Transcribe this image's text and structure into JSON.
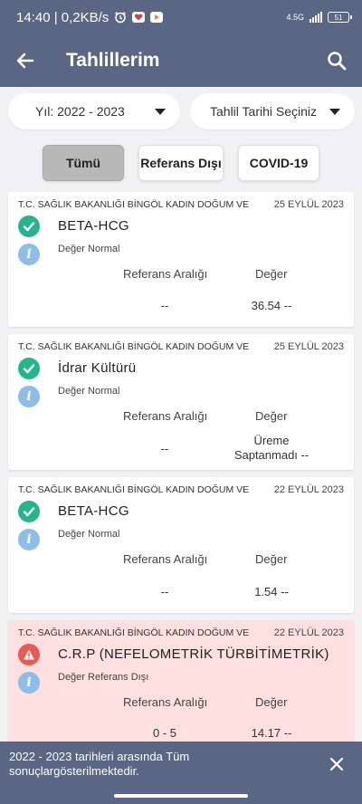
{
  "status_bar": {
    "time_speed": "14:40 | 0,2KB/s",
    "network_label": "4.5G",
    "battery_level": "51"
  },
  "app_bar": {
    "title": "Tahlillerim"
  },
  "filters": {
    "year": "Yıl: 2022 - 2023",
    "date": "Tahlil Tarihi Seçiniz"
  },
  "tabs": [
    "Tümü",
    "Referans Dışı",
    "COVID-19"
  ],
  "selected_tab": "Tümü",
  "results": [
    {
      "institution": "T.C. SAĞLIK BAKANLIĞI BİNGÖL KADIN DOĞUM VE",
      "date": "25 EYLÜL 2023",
      "test": "BETA-HCG",
      "status": "Değer Normal",
      "ref_header": "Referans Aralığı",
      "val_header": "Değer",
      "reference": "--",
      "value": "36.54 --"
    },
    {
      "institution": "T.C. SAĞLIK BAKANLIĞI BİNGÖL KADIN DOĞUM VE",
      "date": "25 EYLÜL 2023",
      "test": "İdrar Kültürü",
      "status": "Değer Normal",
      "ref_header": "Referans Aralığı",
      "val_header": "Değer",
      "reference": "--",
      "value_line1": "Üreme",
      "value_line2": "Saptanmadı --"
    },
    {
      "institution": "T.C. SAĞLIK BAKANLIĞI BİNGÖL KADIN DOĞUM VE",
      "date": "22 EYLÜL 2023",
      "test": "BETA-HCG",
      "status": "Değer Normal",
      "ref_header": "Referans Aralığı",
      "val_header": "Değer",
      "reference": "--",
      "value": "1.54 --"
    },
    {
      "institution": "T.C. SAĞLIK BAKANLIĞI BİNGÖL KADIN DOĞUM VE",
      "date": "22 EYLÜL 2023",
      "test": "C.R.P (NEFELOMETRİK  TÜRBİTİMETRİK)",
      "status": "Değer Referans Dışı",
      "ref_header": "Referans Aralığı",
      "val_header": "Değer",
      "reference": "0 - 5",
      "value": "14.17 --"
    }
  ],
  "snackbar": {
    "message_line1": "2022 - 2023 tarihleri arasında Tüm",
    "message_line2": "sonuçlargösterilmektedir."
  },
  "colors": {
    "primary": "#5a6683",
    "ok": "#27b48d",
    "warning": "#e85a52",
    "info": "#8ebde8",
    "danger_bg": "#fde0df"
  },
  "icons": {
    "back": "arrow-left-icon",
    "search": "search-icon",
    "ok": "check-circle-icon",
    "warning": "warning-triangle-icon",
    "info": "info-icon",
    "close": "close-icon"
  }
}
